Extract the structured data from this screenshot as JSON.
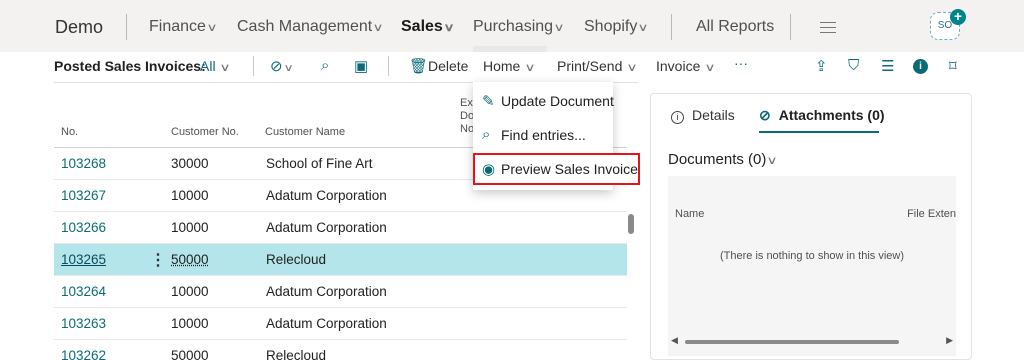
{
  "topnav": {
    "brand": "Demo",
    "items": [
      "Finance",
      "Cash Management",
      "Sales",
      "Purchasing",
      "Shopify"
    ],
    "all_reports": "All Reports",
    "avatar_initials": "SO",
    "avatar_plus": "+"
  },
  "actionbar": {
    "page_title": "Posted Sales Invoices:",
    "filter": "All",
    "delete": "Delete",
    "home": "Home",
    "print_send": "Print/Send",
    "invoice": "Invoice",
    "more": "···"
  },
  "list": {
    "headers": {
      "no": "No.",
      "customer_no": "Customer No.",
      "customer_name": "Customer Name",
      "ext_doc_1": "Ext",
      "ext_doc_2": "Do",
      "ext_doc_3": "No"
    },
    "rows": [
      {
        "no": "103268",
        "customer_no": "30000",
        "customer_name": "School of Fine Art"
      },
      {
        "no": "103267",
        "customer_no": "10000",
        "customer_name": "Adatum Corporation"
      },
      {
        "no": "103266",
        "customer_no": "10000",
        "customer_name": "Adatum Corporation"
      },
      {
        "no": "103265",
        "customer_no": "50000",
        "customer_name": "Relecloud"
      },
      {
        "no": "103264",
        "customer_no": "10000",
        "customer_name": "Adatum Corporation"
      },
      {
        "no": "103263",
        "customer_no": "10000",
        "customer_name": "Adatum Corporation"
      },
      {
        "no": "103262",
        "customer_no": "50000",
        "customer_name": "Relecloud"
      }
    ],
    "row_menu": "⋮"
  },
  "home_menu": {
    "items": [
      "Update Document",
      "Find entries...",
      "Preview Sales Invoice"
    ]
  },
  "factbox": {
    "tab_details": "Details",
    "tab_attachments": "Attachments (0)",
    "documents_title": "Documents (0)",
    "col_name": "Name",
    "col_ext": "File Exten",
    "empty_message": "(There is nothing to show in this view)"
  },
  "colors": {
    "accent": "#0b6a78",
    "selected_row": "#b4e5ea",
    "highlight_border": "#e3141c"
  }
}
